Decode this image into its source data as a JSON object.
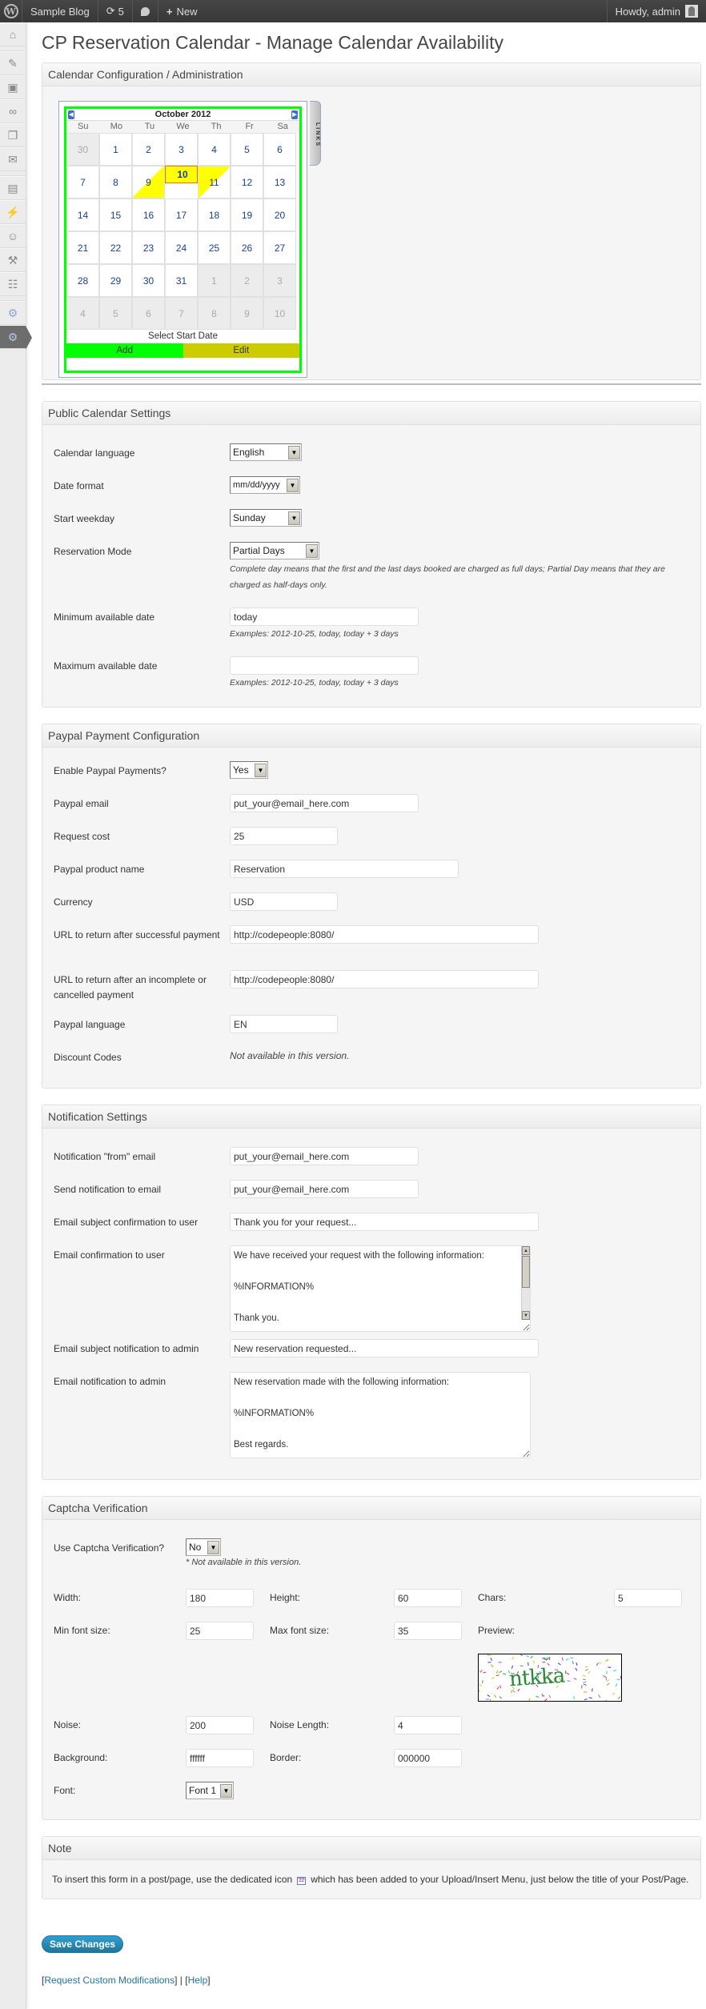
{
  "adminbar": {
    "site_name": "Sample Blog",
    "updates_count": "5",
    "new_label": "New",
    "greeting": "Howdy, admin"
  },
  "sidebar": {
    "items": [
      {
        "icon": "dashboard-icon",
        "glyph": "⌂"
      },
      {
        "icon": "posts-icon",
        "glyph": "✎"
      },
      {
        "icon": "media-icon",
        "glyph": "▣"
      },
      {
        "icon": "links-icon",
        "glyph": "∞"
      },
      {
        "icon": "pages-icon",
        "glyph": "❐"
      },
      {
        "icon": "comments-icon",
        "glyph": "✉"
      },
      {
        "icon": "appearance-icon",
        "glyph": "▤"
      },
      {
        "icon": "plugins-icon",
        "glyph": "⚡"
      },
      {
        "icon": "users-icon",
        "glyph": "☺"
      },
      {
        "icon": "tools-icon",
        "glyph": "⚒"
      },
      {
        "icon": "settings-icon",
        "glyph": "☷"
      },
      {
        "icon": "plugin-settings-icon",
        "glyph": "⚙"
      },
      {
        "icon": "active-plugin-icon",
        "glyph": "⚙"
      }
    ]
  },
  "page_title": "CP Reservation Calendar - Manage Calendar Availability",
  "calendar_admin": {
    "heading": "Calendar Configuration / Administration",
    "links_tab": "LINKS",
    "month_label": "October 2012",
    "weekdays": [
      "Su",
      "Mo",
      "Tu",
      "We",
      "Th",
      "Fr",
      "Sa"
    ],
    "days": [
      {
        "n": "30",
        "type": "other"
      },
      {
        "n": "1"
      },
      {
        "n": "2"
      },
      {
        "n": "3"
      },
      {
        "n": "4"
      },
      {
        "n": "5"
      },
      {
        "n": "6"
      },
      {
        "n": "7"
      },
      {
        "n": "8"
      },
      {
        "n": "9",
        "type": "start"
      },
      {
        "n": "10",
        "type": "sel"
      },
      {
        "n": "11",
        "type": "end"
      },
      {
        "n": "12"
      },
      {
        "n": "13"
      },
      {
        "n": "14"
      },
      {
        "n": "15"
      },
      {
        "n": "16"
      },
      {
        "n": "17"
      },
      {
        "n": "18"
      },
      {
        "n": "19"
      },
      {
        "n": "20"
      },
      {
        "n": "21"
      },
      {
        "n": "22"
      },
      {
        "n": "23"
      },
      {
        "n": "24"
      },
      {
        "n": "25"
      },
      {
        "n": "26"
      },
      {
        "n": "27"
      },
      {
        "n": "28"
      },
      {
        "n": "29"
      },
      {
        "n": "30"
      },
      {
        "n": "31"
      },
      {
        "n": "1",
        "type": "other"
      },
      {
        "n": "2",
        "type": "other"
      },
      {
        "n": "3",
        "type": "other"
      },
      {
        "n": "4",
        "type": "other"
      },
      {
        "n": "5",
        "type": "other"
      },
      {
        "n": "6",
        "type": "other"
      },
      {
        "n": "7",
        "type": "other"
      },
      {
        "n": "8",
        "type": "other"
      },
      {
        "n": "9",
        "type": "other"
      },
      {
        "n": "10",
        "type": "other"
      }
    ],
    "status_text": "Select Start Date",
    "add_label": "Add",
    "edit_label": "Edit",
    "colors": {
      "border": "#00ff00",
      "selected": "#ffff00",
      "add": "#00ff00",
      "edit": "#cccc00"
    }
  },
  "public_settings": {
    "heading": "Public Calendar Settings",
    "language_label": "Calendar language",
    "language_value": "English",
    "date_format_label": "Date format",
    "date_format_value": "mm/dd/yyyy",
    "start_weekday_label": "Start weekday",
    "start_weekday_value": "Sunday",
    "mode_label": "Reservation Mode",
    "mode_value": "Partial Days",
    "mode_hint": "Complete day means that the first and the last days booked are charged as full days; Partial Day means that they are charged as half-days only.",
    "min_date_label": "Minimum available date",
    "min_date_value": "today",
    "min_date_hint": "Examples: 2012-10-25, today, today + 3 days",
    "max_date_label": "Maximum available date",
    "max_date_value": "",
    "max_date_hint": "Examples: 2012-10-25, today, today + 3 days"
  },
  "paypal": {
    "heading": "Paypal Payment Configuration",
    "enable_label": "Enable Paypal Payments?",
    "enable_value": "Yes",
    "email_label": "Paypal email",
    "email_value": "put_your@email_here.com",
    "cost_label": "Request cost",
    "cost_value": "25",
    "product_label": "Paypal product name",
    "product_value": "Reservation",
    "currency_label": "Currency",
    "currency_value": "USD",
    "url_ok_label": "URL to return after successful payment",
    "url_ok_value": "http://codepeople:8080/",
    "url_cancel_label": "URL to return after an incomplete or cancelled payment",
    "url_cancel_value": "http://codepeople:8080/",
    "language_label": "Paypal language",
    "language_value": "EN",
    "discount_label": "Discount Codes",
    "discount_value": "Not available in this version."
  },
  "notifications": {
    "heading": "Notification Settings",
    "from_label": "Notification \"from\" email",
    "from_value": "put_your@email_here.com",
    "to_label": "Send notification to email",
    "to_value": "put_your@email_here.com",
    "subj_user_label": "Email subject confirmation to user",
    "subj_user_value": "Thank you for your request...",
    "body_user_label": "Email confirmation to user",
    "body_user_value": "We have received your request with the following information:\n\n\n%INFORMATION%\n\n\nThank you.",
    "subj_admin_label": "Email subject notification to admin",
    "subj_admin_value": "New reservation requested...",
    "body_admin_label": "Email notification to admin",
    "body_admin_value": "New reservation made with the following information:\n\n\n%INFORMATION%\n\n\nBest regards."
  },
  "captcha": {
    "heading": "Captcha Verification",
    "use_label": "Use Captcha Verification?",
    "use_value": "No",
    "use_hint": "* Not available in this version.",
    "width_label": "Width:",
    "width_value": "180",
    "height_label": "Height:",
    "height_value": "60",
    "chars_label": "Chars:",
    "chars_value": "5",
    "min_font_label": "Min font size:",
    "min_font_value": "25",
    "max_font_label": "Max font size:",
    "max_font_value": "35",
    "preview_label": "Preview:",
    "preview_text": "ntkka",
    "noise_label": "Noise:",
    "noise_value": "200",
    "noise_len_label": "Noise Length:",
    "noise_len_value": "4",
    "bg_label": "Background:",
    "bg_value": "ffffff",
    "border_label": "Border:",
    "border_value": "000000",
    "font_label": "Font:",
    "font_value": "Font 1"
  },
  "note": {
    "heading": "Note",
    "text_before": "To insert this form in a post/page, use the dedicated icon",
    "text_after": "which has been added to your Upload/Insert Menu, just below the title of your Post/Page."
  },
  "footer": {
    "save_label": "Save Changes",
    "custom_mod_link": "Request Custom Modifications",
    "help_link": "Help",
    "separator": "|"
  }
}
